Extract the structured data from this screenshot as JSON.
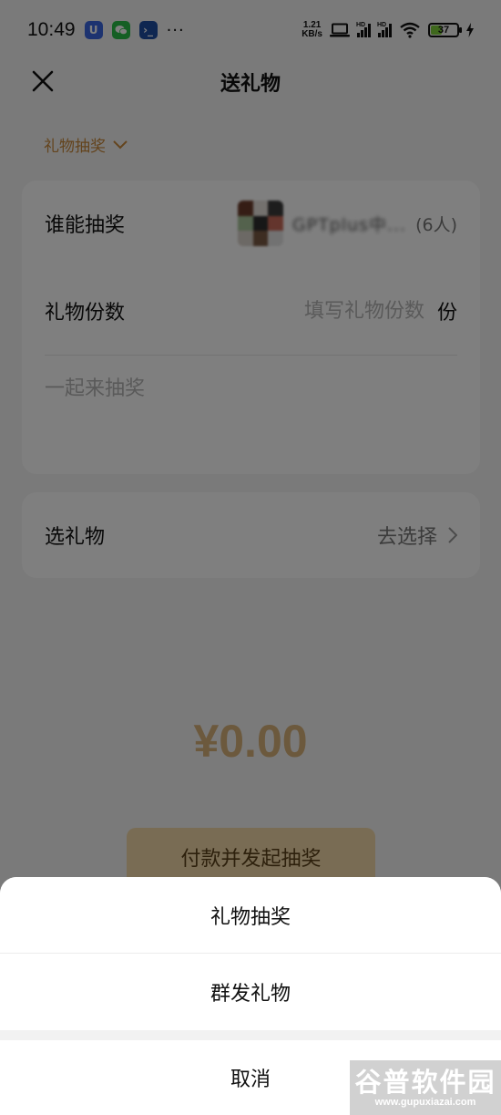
{
  "status_bar": {
    "time": "10:49",
    "more": "···",
    "speed_value": "1.21",
    "speed_unit": "KB/s",
    "hd_label": "HD",
    "battery": "37"
  },
  "header": {
    "title": "送礼物"
  },
  "mode_selector": {
    "label": "礼物抽奖"
  },
  "lottery_form": {
    "who_label": "谁能抽奖",
    "group_name": "GPTplus中...",
    "member_count": "(6人)",
    "count_label": "礼物份数",
    "count_placeholder": "填写礼物份数",
    "count_unit": "份",
    "message_placeholder": "一起来抽奖"
  },
  "gift": {
    "label": "选礼物",
    "action": "去选择"
  },
  "amount": "¥0.00",
  "pay_button": "付款并发起抽奖",
  "action_sheet": {
    "options": [
      "礼物抽奖",
      "群发礼物"
    ],
    "cancel": "取消"
  },
  "watermark": {
    "title": "谷普软件园",
    "url": "www.gupuxiazai.com"
  },
  "colors": {
    "accent": "#c8893b",
    "amount": "#d9b27a",
    "pay_button_bg": "#f3d8a8"
  }
}
